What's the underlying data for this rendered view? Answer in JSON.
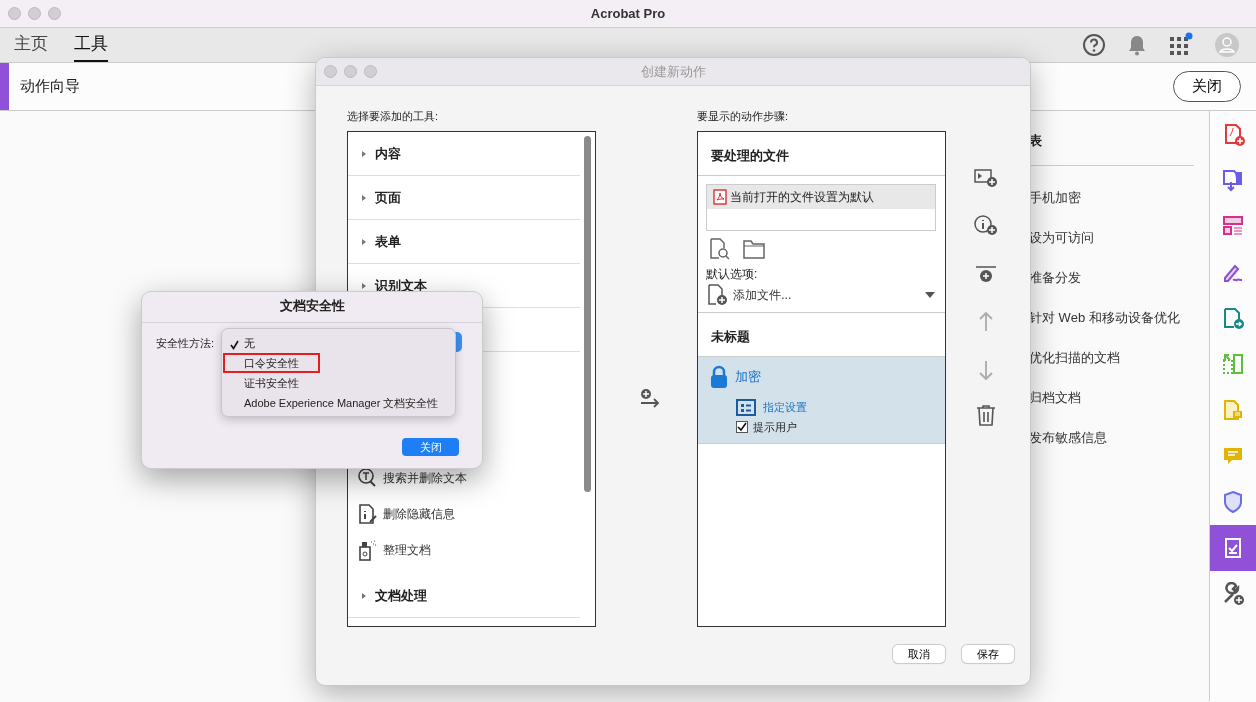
{
  "window": {
    "title": "Acrobat Pro"
  },
  "nav": {
    "tabs": [
      {
        "label": "主页",
        "selected": false
      },
      {
        "label": "工具",
        "selected": true
      }
    ],
    "notification_dot": true
  },
  "toolbar": {
    "title": "动作向导",
    "close_button": "关闭"
  },
  "side_panel": {
    "heading": "表",
    "items": [
      "手机加密",
      "设为可访问",
      "准备分发",
      "针对 Web 和移动设备优化",
      "优化扫描的文档",
      "归档文档",
      "发布敏感信息"
    ]
  },
  "tool_strip": [
    {
      "kind": "create",
      "selected": false
    },
    {
      "kind": "export",
      "selected": false
    },
    {
      "kind": "organize",
      "selected": false
    },
    {
      "kind": "sign",
      "selected": false
    },
    {
      "kind": "send",
      "selected": false
    },
    {
      "kind": "compare",
      "selected": false
    },
    {
      "kind": "note",
      "selected": false
    },
    {
      "kind": "comment",
      "selected": false
    },
    {
      "kind": "protect",
      "selected": false
    },
    {
      "kind": "action",
      "selected": true
    },
    {
      "kind": "more",
      "selected": false
    }
  ],
  "action_dialog": {
    "title": "创建新动作",
    "tools_label": "选择要添加的工具:",
    "tool_list": [
      {
        "kind": "group",
        "label": "内容"
      },
      {
        "kind": "group",
        "label": "页面"
      },
      {
        "kind": "group",
        "label": "表单"
      },
      {
        "kind": "group",
        "label": "识别文本"
      },
      {
        "kind": "spacer"
      },
      {
        "kind": "search-remove",
        "label": "搜索并删除文本"
      },
      {
        "kind": "remove-info",
        "label": "删除隐藏信息"
      },
      {
        "kind": "sanitize",
        "label": "整理文档"
      },
      {
        "kind": "group",
        "label": "文档处理"
      }
    ],
    "steps_label": "要显示的动作步骤:",
    "files_heading": "要处理的文件",
    "files": [
      {
        "label": "当前打开的文件设置为默认",
        "selected": true
      }
    ],
    "default_options_label": "默认选项:",
    "add_file": "添加文件...",
    "untitled": "未标题",
    "action": {
      "label": "加密",
      "selected": true,
      "settings_label": "指定设置",
      "prompt_user": {
        "label": "提示用户",
        "checked": true
      }
    },
    "buttons": [
      "取消",
      "保存"
    ]
  },
  "security_dialog": {
    "title": "文档安全性",
    "method_label": "安全性方法:",
    "options": [
      {
        "label": "无",
        "checked": true,
        "highlighted": false
      },
      {
        "label": "口令安全性",
        "checked": false,
        "highlighted": true
      },
      {
        "label": "证书安全性",
        "checked": false,
        "highlighted": false
      },
      {
        "label": "Adobe Experience Manager 文档安全性",
        "checked": false,
        "highlighted": false
      }
    ],
    "close_button": "关闭"
  }
}
